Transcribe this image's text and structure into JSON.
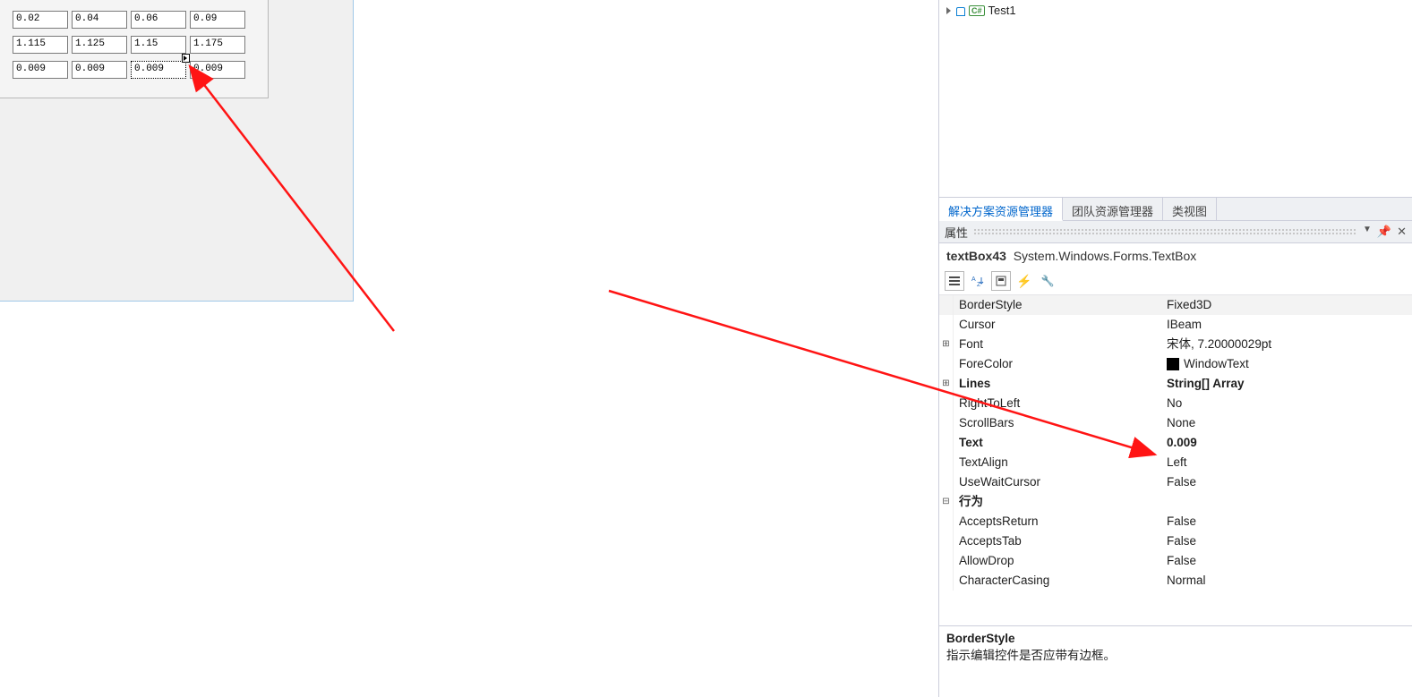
{
  "designer": {
    "grid": [
      [
        "0.02",
        "0.04",
        "0.06",
        "0.09"
      ],
      [
        "1.115",
        "1.125",
        "1.15",
        "1.175"
      ],
      [
        "0.009",
        "0.009",
        "0.009",
        "0.009"
      ]
    ],
    "selected_cell": {
      "row": 2,
      "col": 2
    }
  },
  "solution": {
    "tree_item": "Test1"
  },
  "tabs": {
    "t0": "解决方案资源管理器",
    "t1": "团队资源管理器",
    "t2": "类视图",
    "active": 0
  },
  "propsPanel": {
    "title": "属性",
    "object_name": "textBox43",
    "object_type": "System.Windows.Forms.TextBox"
  },
  "props": {
    "BorderStyle": {
      "label": "BorderStyle",
      "value": "Fixed3D"
    },
    "Cursor": {
      "label": "Cursor",
      "value": "IBeam"
    },
    "Font": {
      "label": "Font",
      "value": "宋体, 7.20000029pt",
      "expand": "plus"
    },
    "ForeColor": {
      "label": "ForeColor",
      "value": "WindowText",
      "swatch": "#000000"
    },
    "Lines": {
      "label": "Lines",
      "value": "String[] Array",
      "expand": "plus",
      "bold": true
    },
    "RightToLeft": {
      "label": "RightToLeft",
      "value": "No"
    },
    "ScrollBars": {
      "label": "ScrollBars",
      "value": "None"
    },
    "Text": {
      "label": "Text",
      "value": "0.009",
      "bold": true
    },
    "TextAlign": {
      "label": "TextAlign",
      "value": "Left"
    },
    "UseWaitCursor": {
      "label": "UseWaitCursor",
      "value": "False"
    },
    "cat_behavior": {
      "label": "行为"
    },
    "AcceptsReturn": {
      "label": "AcceptsReturn",
      "value": "False"
    },
    "AcceptsTab": {
      "label": "AcceptsTab",
      "value": "False"
    },
    "AllowDrop": {
      "label": "AllowDrop",
      "value": "False"
    },
    "CharacterCasing": {
      "label": "CharacterCasing",
      "value": "Normal"
    }
  },
  "propDesc": {
    "title": "BorderStyle",
    "text": "指示编辑控件是否应带有边框。"
  }
}
